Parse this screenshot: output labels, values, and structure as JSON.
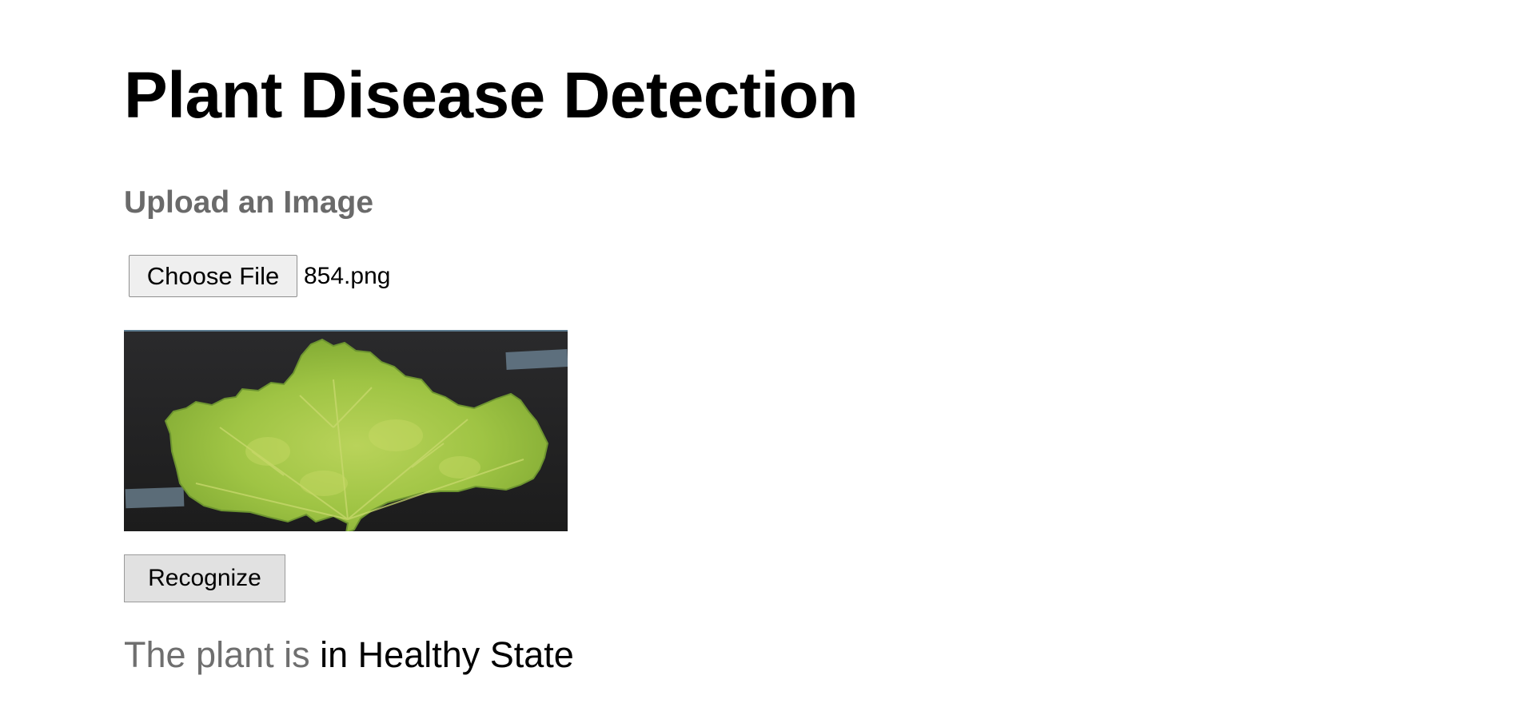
{
  "page": {
    "title": "Plant Disease Detection"
  },
  "upload": {
    "heading": "Upload an Image",
    "choose_file_label": "Choose File",
    "file_name": "854.png"
  },
  "preview": {
    "image_name": "leaf-preview",
    "background_color": "#232323",
    "leaf_color": "#a4c646"
  },
  "actions": {
    "recognize_label": "Recognize"
  },
  "result": {
    "prefix": "The plant is",
    "value": "in Healthy State"
  }
}
